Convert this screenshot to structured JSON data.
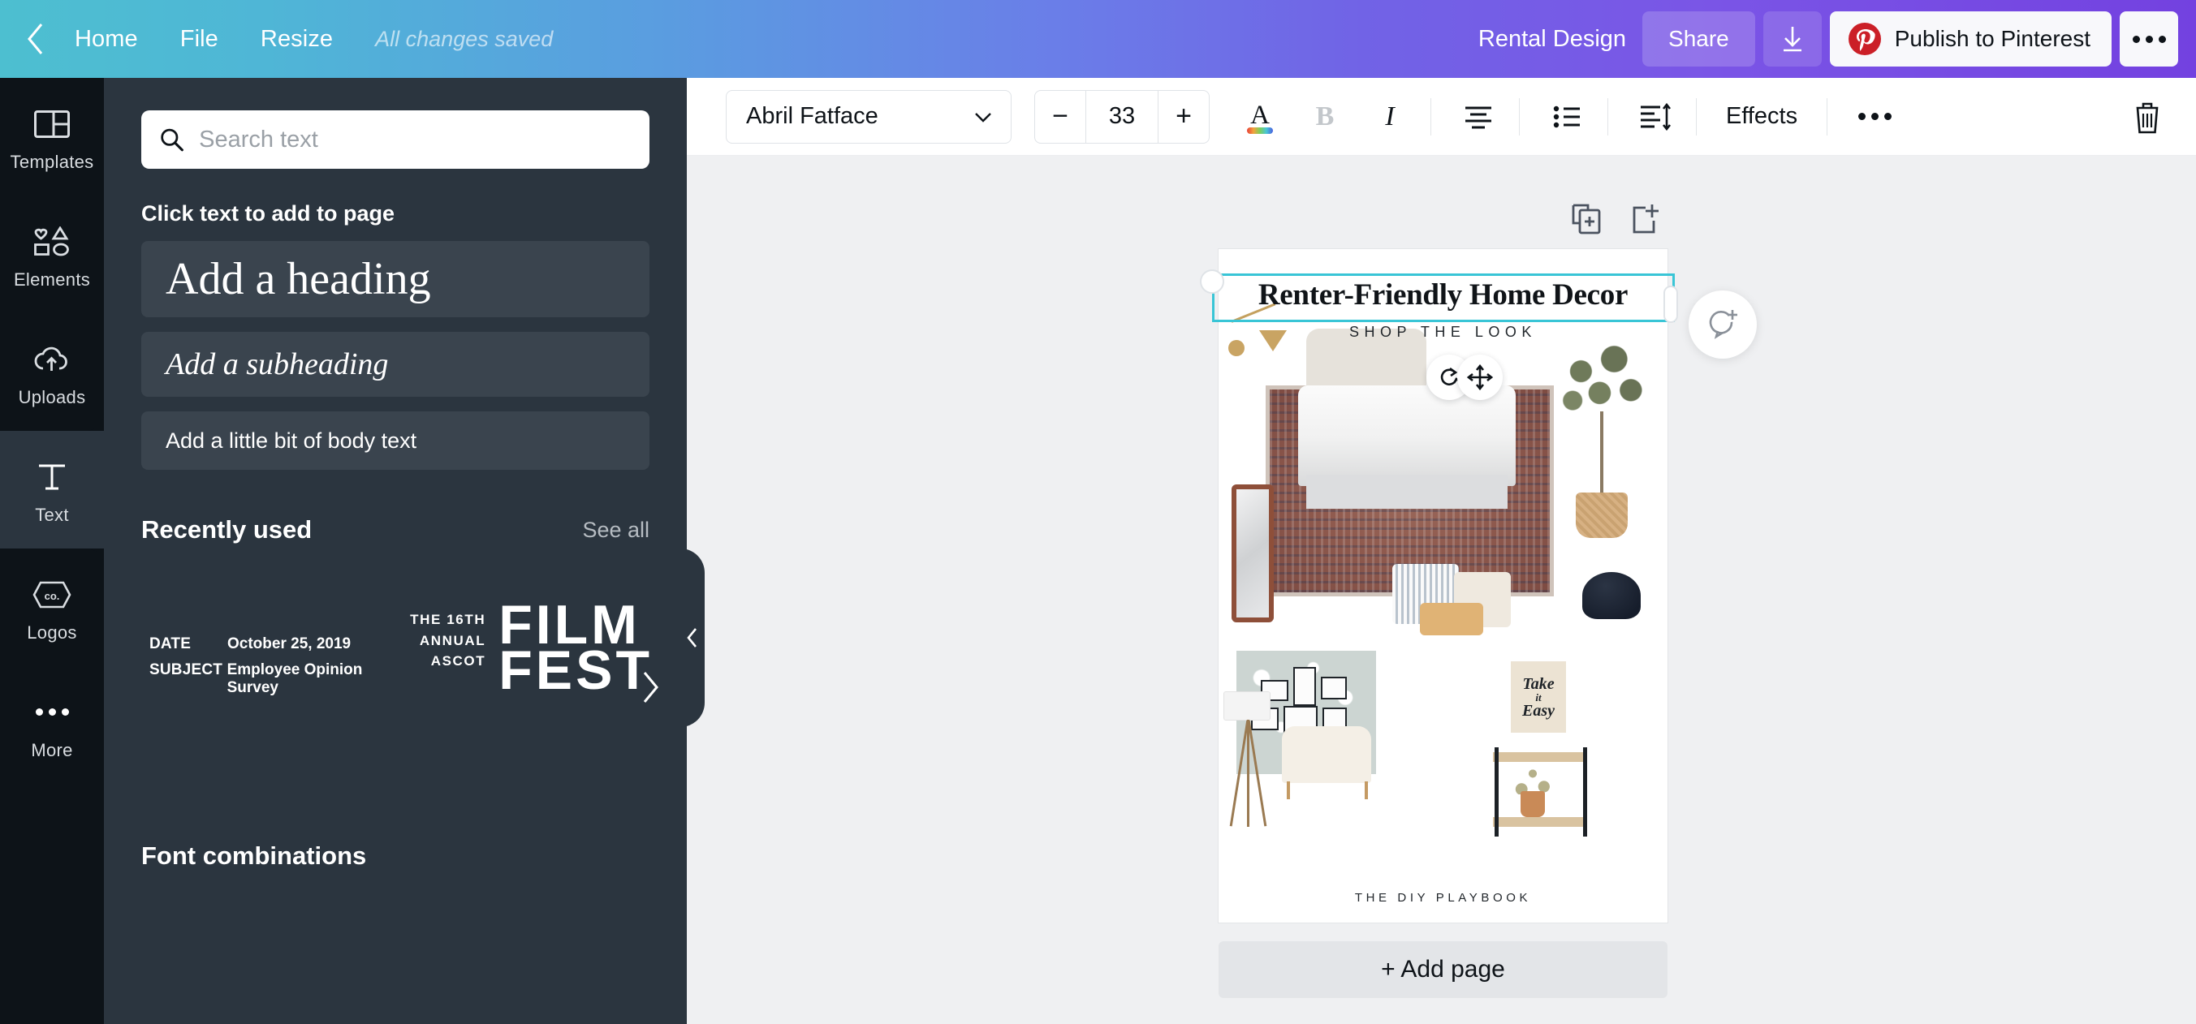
{
  "topbar": {
    "back_icon": "chevron-left-icon",
    "home": "Home",
    "file": "File",
    "resize": "Resize",
    "save_status": "All changes saved",
    "design_title": "Rental Design",
    "share": "Share",
    "download_icon": "download-icon",
    "publish": "Publish to Pinterest",
    "pinterest_icon": "pinterest-icon",
    "more_icon": "more-horizontal-icon",
    "gradient_start": "#4dbfd0",
    "gradient_end": "#7341e0",
    "pinterest_red": "#cb1f27"
  },
  "rail": {
    "items": [
      {
        "label": "Templates",
        "icon": "templates-icon",
        "active": false
      },
      {
        "label": "Elements",
        "icon": "elements-icon",
        "active": false
      },
      {
        "label": "Uploads",
        "icon": "uploads-icon",
        "active": false
      },
      {
        "label": "Text",
        "icon": "text-icon",
        "active": true
      },
      {
        "label": "Logos",
        "icon": "logos-icon",
        "active": false
      },
      {
        "label": "More",
        "icon": "more-icon",
        "active": false
      }
    ]
  },
  "panel": {
    "search_placeholder": "Search text",
    "search_value": "",
    "search_icon": "search-icon",
    "click_heading": "Click text to add to page",
    "add_heading": "Add a heading",
    "add_subheading": "Add a subheading",
    "add_body": "Add a little bit of body text",
    "recently_used": "Recently used",
    "see_all": "See all",
    "font_combinations": "Font combinations",
    "next_icon": "chevron-right-icon",
    "collapse_icon": "chevron-left-icon",
    "recent_items": [
      {
        "type": "memo",
        "date_key": "DATE",
        "date_value": "October 25, 2019",
        "subject_key": "SUBJECT",
        "subject_value": "Employee  Opinion Survey"
      },
      {
        "type": "filmfest",
        "kicker_line1": "THE 16TH",
        "kicker_line2": "ANNUAL",
        "kicker_line3": "ASCOT",
        "title_line1": "FILM",
        "title_line2": "FEST"
      }
    ]
  },
  "toolbar": {
    "font_family": "Abril Fatface",
    "font_family_caret": "chevron-down-icon",
    "decrease_icon": "minus-icon",
    "font_size": "33",
    "increase_icon": "plus-icon",
    "font_color_icon": "font-color-icon",
    "bold_label": "B",
    "italic_label": "I",
    "align_icon": "align-center-icon",
    "list_icon": "bulleted-list-icon",
    "spacing_icon": "line-spacing-icon",
    "effects": "Effects",
    "more_icon": "more-horizontal-icon",
    "delete_icon": "trash-icon"
  },
  "canvas": {
    "duplicate_page_icon": "duplicate-page-icon",
    "add_page_icon": "add-page-icon",
    "rotate_icon": "rotate-icon",
    "move_icon": "move-icon",
    "comment_icon": "add-comment-icon",
    "add_page_label": "+ Add page",
    "selection_color": "#39c5d6",
    "design": {
      "title": "Renter-Friendly Home Decor",
      "subtitle": "SHOP THE LOOK",
      "footer": "THE DIY PLAYBOOK",
      "flag_text_1": "Take",
      "flag_text_2": "it",
      "flag_text_3": "Easy"
    }
  }
}
